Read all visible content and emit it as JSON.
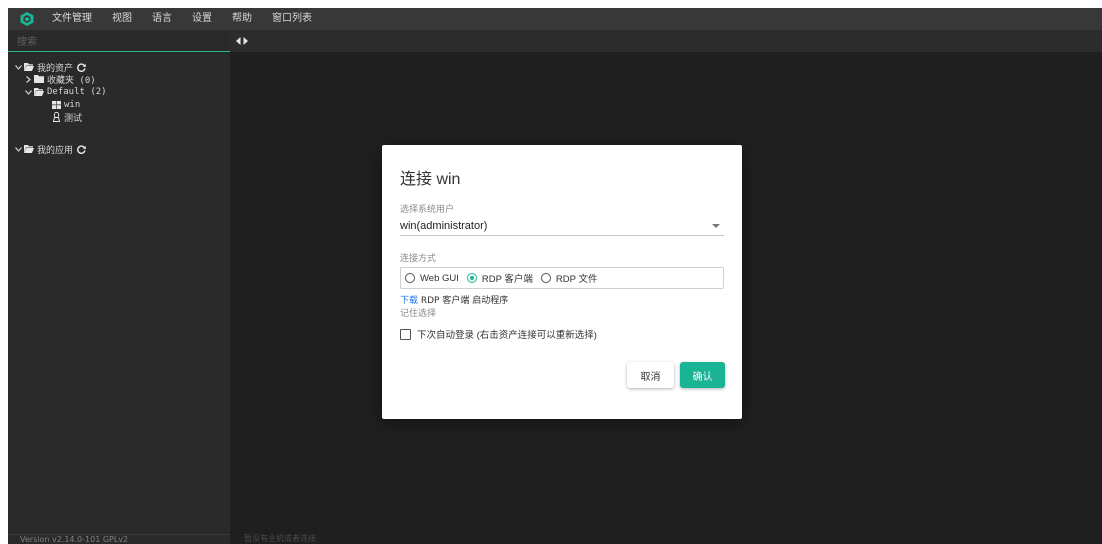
{
  "menubar": {
    "items": [
      "文件管理",
      "视图",
      "语言",
      "设置",
      "帮助",
      "窗口列表"
    ]
  },
  "sidebar": {
    "search_placeholder": "搜索",
    "tree": {
      "my_assets": "我的资产",
      "favorites": "收藏夹 (0)",
      "default_node": "Default (2)",
      "asset_win": "win",
      "asset_test": "测试",
      "my_apps": "我的应用"
    },
    "footer": "Version v2.14.0-101 GPLv2"
  },
  "main": {
    "footer": "暂没有主机或者连接"
  },
  "dialog": {
    "title": "连接 win",
    "user_label": "选择系统用户",
    "user_value": "win(administrator)",
    "method_label": "连接方式",
    "methods": [
      "Web GUI",
      "RDP 客户端",
      "RDP 文件"
    ],
    "selected_method": "RDP 客户端",
    "download_link": "下载",
    "download_rest": " RDP 客户端 启动程序",
    "remember_label": "记住选择",
    "auto_login": "下次自动登录 (右击资产连接可以重新选择)",
    "cancel": "取消",
    "confirm": "确认"
  },
  "colors": {
    "accent": "#1ab394",
    "link": "#1a73e8",
    "menubar_bg": "#383838",
    "sidebar_bg": "#2a2a2a",
    "main_bg": "#1f1f1f"
  },
  "icons": {
    "logo": "jumpserver-logo-icon",
    "folder": "folder-icon",
    "refresh": "refresh-icon",
    "windows": "windows-icon",
    "linux": "linux-icon",
    "collapse": "collapse-toggle-icon"
  }
}
